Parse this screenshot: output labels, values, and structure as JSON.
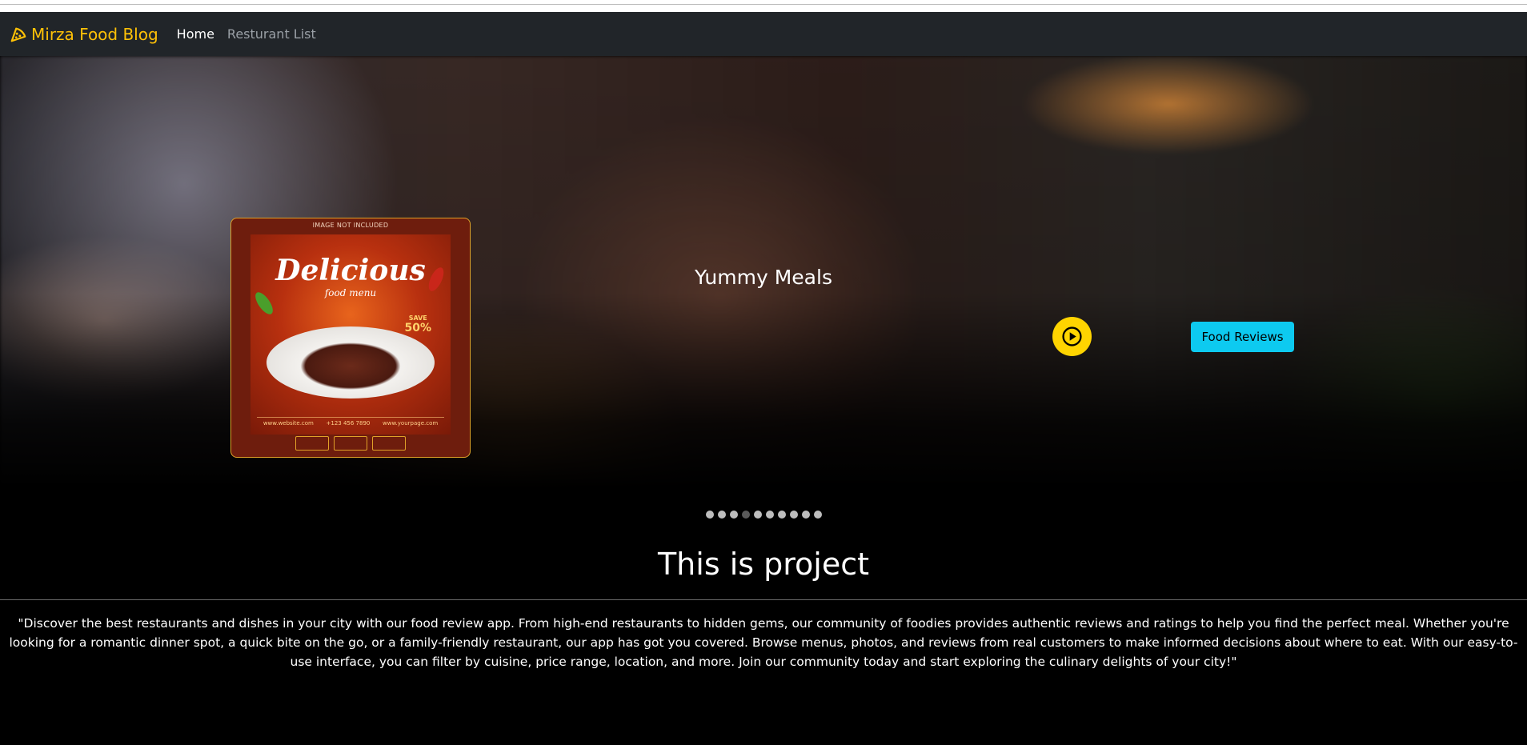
{
  "navbar": {
    "brand": "Mirza Food Blog",
    "links": [
      {
        "label": "Home",
        "active": true
      },
      {
        "label": "Resturant List",
        "active": false
      }
    ],
    "colors": {
      "brand": "#ffc107",
      "background": "#212529"
    }
  },
  "carousel": {
    "caption": "Yummy Meals",
    "poster": {
      "top_note": "IMAGE NOT INCLUDED",
      "title": "Delicious",
      "subtitle": "food menu",
      "save_label": "SAVE",
      "save_value": "50%",
      "footer_items": [
        "www.website.com",
        "+123 456 7890",
        "www.yourpage.com"
      ]
    },
    "play_icon": "play-circle-icon",
    "reviews_button": "Food Reviews",
    "indicator_count": 10,
    "active_index": 3,
    "colors": {
      "play": "#ffd400",
      "reviews": "#0dcaf0"
    }
  },
  "content": {
    "title": "This is project",
    "description": "\"Discover the best restaurants and dishes in your city with our food review app. From high-end restaurants to hidden gems, our community of foodies provides authentic reviews and ratings to help you find the perfect meal. Whether you're looking for a romantic dinner spot, a quick bite on the go, or a family-friendly restaurant, our app has got you covered. Browse menus, photos, and reviews from real customers to make informed decisions about where to eat. With our easy-to-use interface, you can filter by cuisine, price range, location, and more. Join our community today and start exploring the culinary delights of your city!\""
  }
}
